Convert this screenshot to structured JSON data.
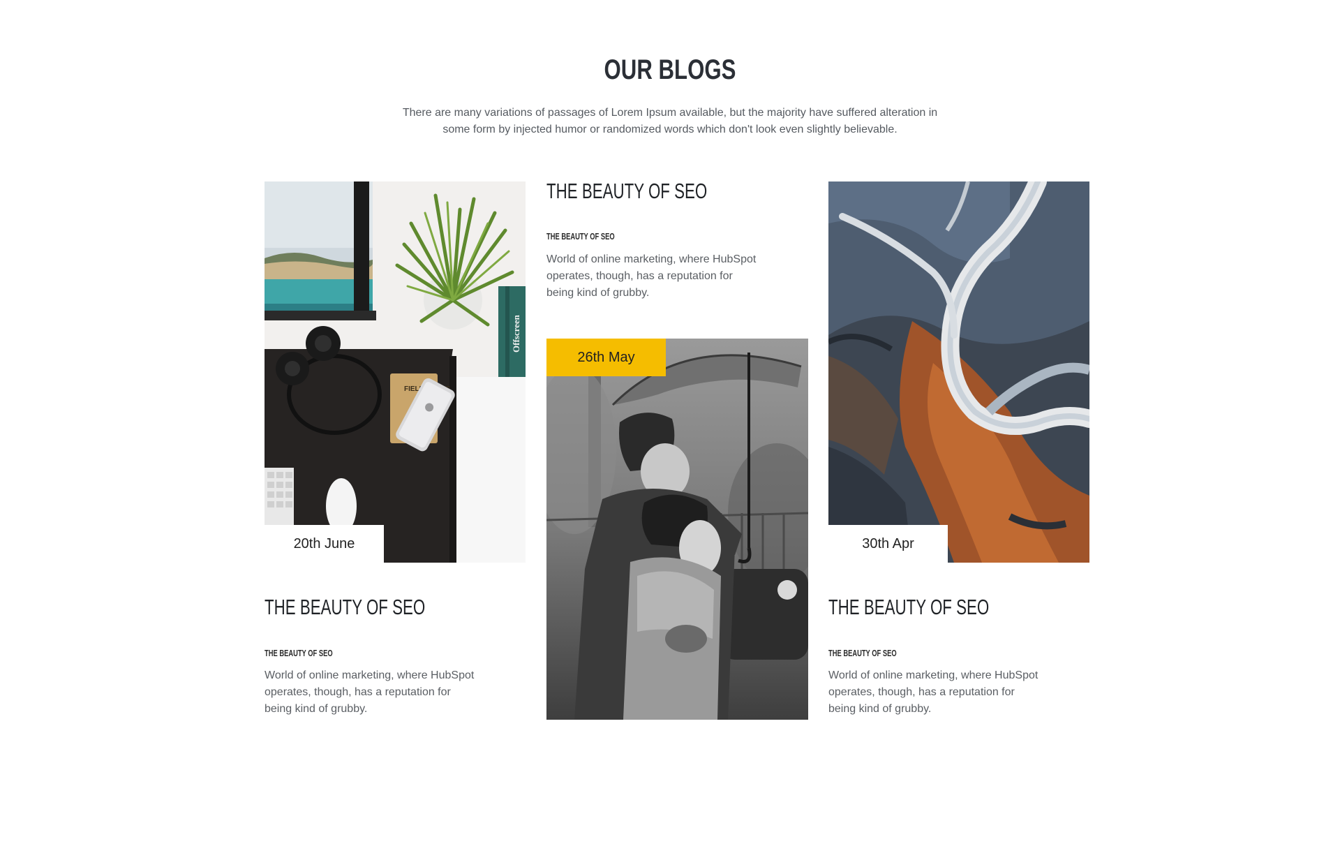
{
  "section": {
    "title": "OUR BLOGS",
    "intro": "There are many variations of passages of Lorem Ipsum available, but the majority have suffered alteration in some form by injected humor or randomized words which don't look even slightly believable."
  },
  "accent_color": "#f5bd00",
  "posts": [
    {
      "date": "20th June",
      "title": "THE BEAUTY OF SEO",
      "subtitle": "THE BEAUTY OF SEO",
      "text": "World of online marketing, where HubSpot operates, though, has a reputation for being kind of grubby.",
      "image": "desk-flatlay-photo",
      "photo_text": {
        "notebook": "FIELD NOTES",
        "book_spine": "Offscreen"
      }
    },
    {
      "date": "26th May",
      "title": "THE BEAUTY OF SEO",
      "subtitle": "THE BEAUTY OF SEO",
      "text": "World of online marketing, where HubSpot operates, though, has a reputation for being kind of grubby.",
      "image": "couple-umbrella-photo"
    },
    {
      "date": "30th Apr",
      "title": "THE BEAUTY OF SEO",
      "subtitle": "THE BEAUTY OF SEO",
      "text": "World of online marketing, where HubSpot operates, though, has a reputation for being kind of grubby.",
      "image": "aerial-river-photo"
    }
  ]
}
